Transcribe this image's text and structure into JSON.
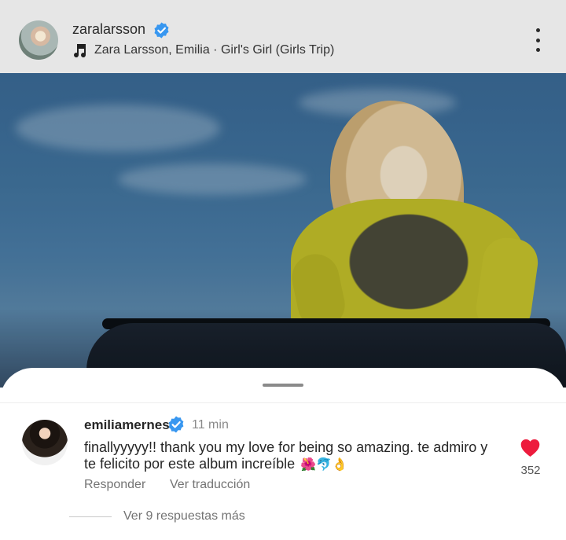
{
  "post": {
    "username": "zaralarsson",
    "music": "Zara Larsson, Emilia · Girl's Girl (Girls Trip)",
    "icons": {
      "avatar": "profile-photo",
      "verified": "verified-badge-icon",
      "music": "music-note-icon",
      "more": "more-vertical-icon"
    }
  },
  "comment": {
    "username": "emiliamernes",
    "time": "11 min",
    "text": "finallyyyyy!! thank you my love for being so amazing. te admiro y te felicito por este album increíble",
    "emojis": "🌺🐬👌",
    "reply_label": "Responder",
    "translate_label": "Ver traducción",
    "likes": "352",
    "replies_label": "Ver 9 respuestas más",
    "liked": true
  },
  "colors": {
    "verified": "#3897f0",
    "like": "#ed1b3d",
    "secondary_text": "#737373"
  }
}
